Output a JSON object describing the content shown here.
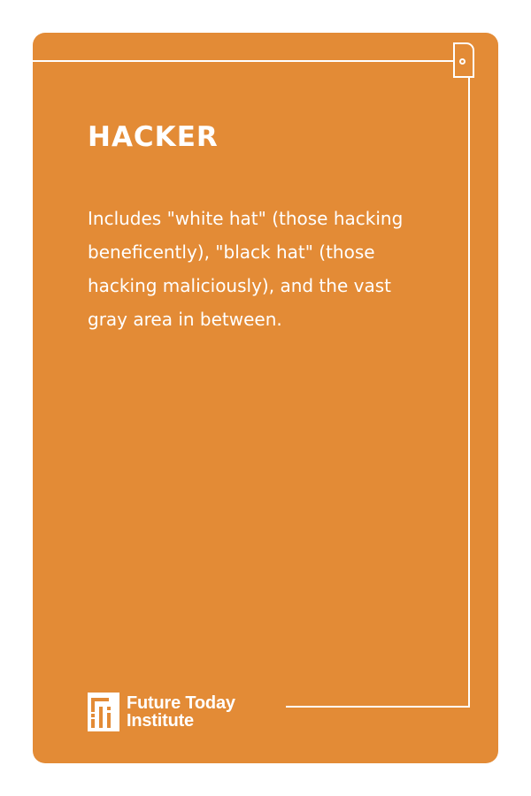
{
  "card": {
    "title": "HACKER",
    "definition": "Includes \"white hat\" (those hacking beneficently), \"black hat\" (those hacking maliciously), and the vast gray area in between.",
    "background_color": "#e38b36",
    "text_color": "#ffffff"
  },
  "brand": {
    "logo_icon": "fti-logo-icon",
    "name_line1": "Future Today",
    "name_line2": "Institute"
  }
}
